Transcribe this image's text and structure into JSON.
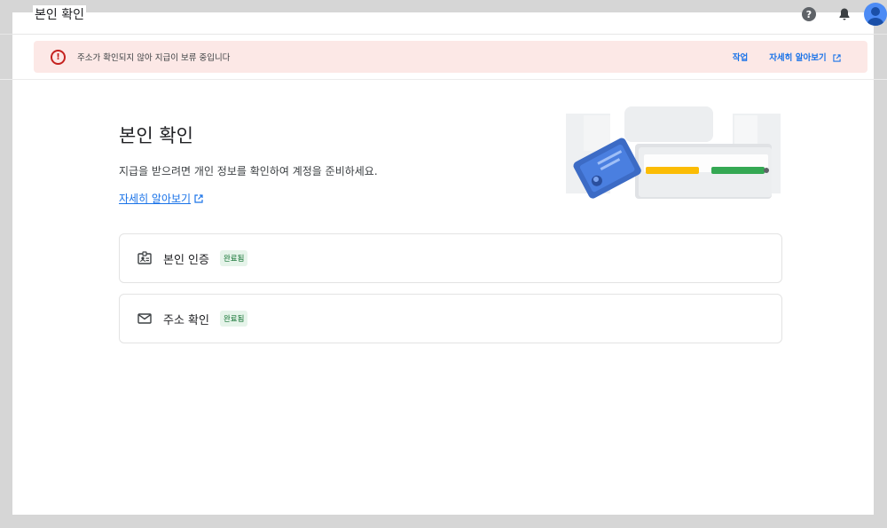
{
  "topbar": {
    "title": "본인 확인",
    "help_glyph": "?"
  },
  "alert": {
    "message": "주소가 확인되지 않아 지급이 보류 중입니다",
    "action_label": "작업",
    "learn_more_label": "자세히 알아보기",
    "icon_glyph": "!"
  },
  "main": {
    "title": "본인 확인",
    "description": "지급을 받으려면 개인 정보를 확인하여 계정을 준비하세요.",
    "learn_more_label": "자세히 알아보기"
  },
  "cards": [
    {
      "label": "본인 인증",
      "status": "완료됨",
      "icon": "id-badge-icon"
    },
    {
      "label": "주소 확인",
      "status": "완료됨",
      "icon": "envelope-icon"
    }
  ],
  "colors": {
    "alert_bg": "#fce8e6",
    "alert_icon": "#c5221f",
    "link": "#1a73e8",
    "badge_text": "#137333",
    "badge_bg": "#e6f4ea"
  }
}
